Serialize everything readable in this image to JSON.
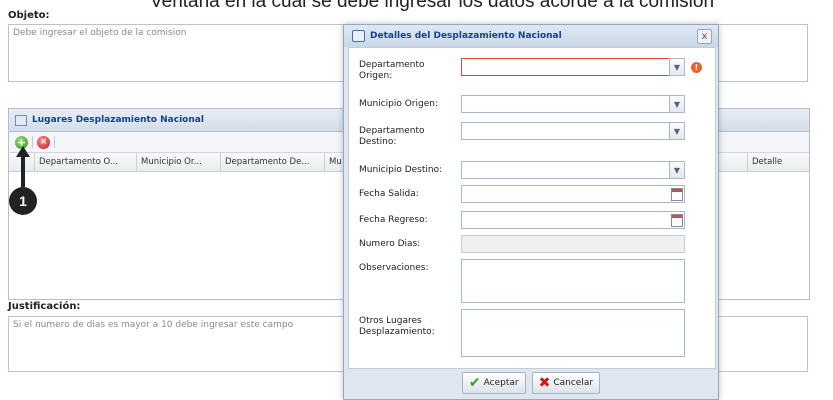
{
  "caption": "Ventana en la cual se debe ingresar los datos acorde a la comisión",
  "objeto": {
    "label": "Objeto:",
    "placeholder": "Debe ingresar el objeto de la comision"
  },
  "lugares_panel": {
    "title": "Lugares Desplazamiento Nacional",
    "columns": [
      "Departamento O...",
      "Municipio Or...",
      "Departamento De...",
      "Mu",
      "Detalle"
    ]
  },
  "step_badge": "1",
  "justificacion": {
    "label": "Justificación:",
    "placeholder": "Si el numero de dias es mayor a 10 debe ingresar este campo"
  },
  "dialog": {
    "title": "Detalles del Desplazamiento Nacional",
    "close": "x",
    "fields": {
      "departamento_origen": "Departamento Origen:",
      "municipio_origen": "Municipio Origen:",
      "departamento_destino": "Departamento Destino:",
      "municipio_destino": "Municipio Destino:",
      "fecha_salida": "Fecha Salida:",
      "fecha_regreso": "Fecha Regreso:",
      "numero_dias": "Numero Dias:",
      "observaciones": "Observaciones:",
      "otros_lugares": "Otros Lugares Desplazamiento:"
    },
    "buttons": {
      "aceptar": "Aceptar",
      "cancelar": "Cancelar"
    }
  },
  "colors": {
    "header_text": "#15428b",
    "error": "#e0463c",
    "accept_icon": "#3aa120",
    "cancel_icon": "#d4151b"
  }
}
